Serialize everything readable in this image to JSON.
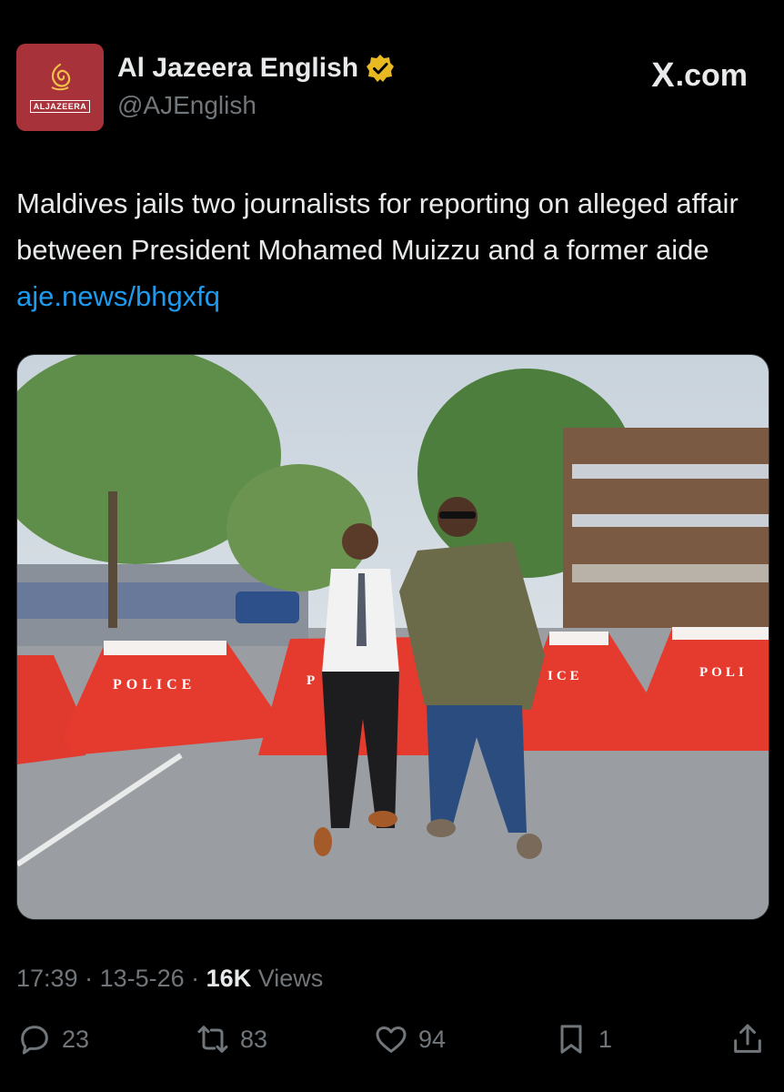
{
  "account": {
    "display_name": "Al Jazeera English",
    "handle": "@AJEnglish",
    "avatar_wordmark": "ALJAZEERA",
    "verified_color": "#e8b923"
  },
  "brand": {
    "site": ".com",
    "site_mark": "X"
  },
  "tweet": {
    "text": "Maldives jails two journalists for reporting on alleged affair between President Mohamed Muizzu and a former aide ",
    "link": "aje.news/bhgxfq",
    "media": {
      "barrier_text_1": "POLICE",
      "barrier_text_2": "P",
      "barrier_text_3": "ICE",
      "barrier_text_4": "POLI"
    }
  },
  "meta": {
    "time": "17:39",
    "date": "13-5-26",
    "views_count": "16K",
    "views_label": " Views"
  },
  "actions": {
    "replies": "23",
    "reposts": "83",
    "likes": "94",
    "bookmarks": "1"
  },
  "colors": {
    "link": "#1d9bf0",
    "muted": "#71767b",
    "avatar_bg": "#a8323a"
  }
}
